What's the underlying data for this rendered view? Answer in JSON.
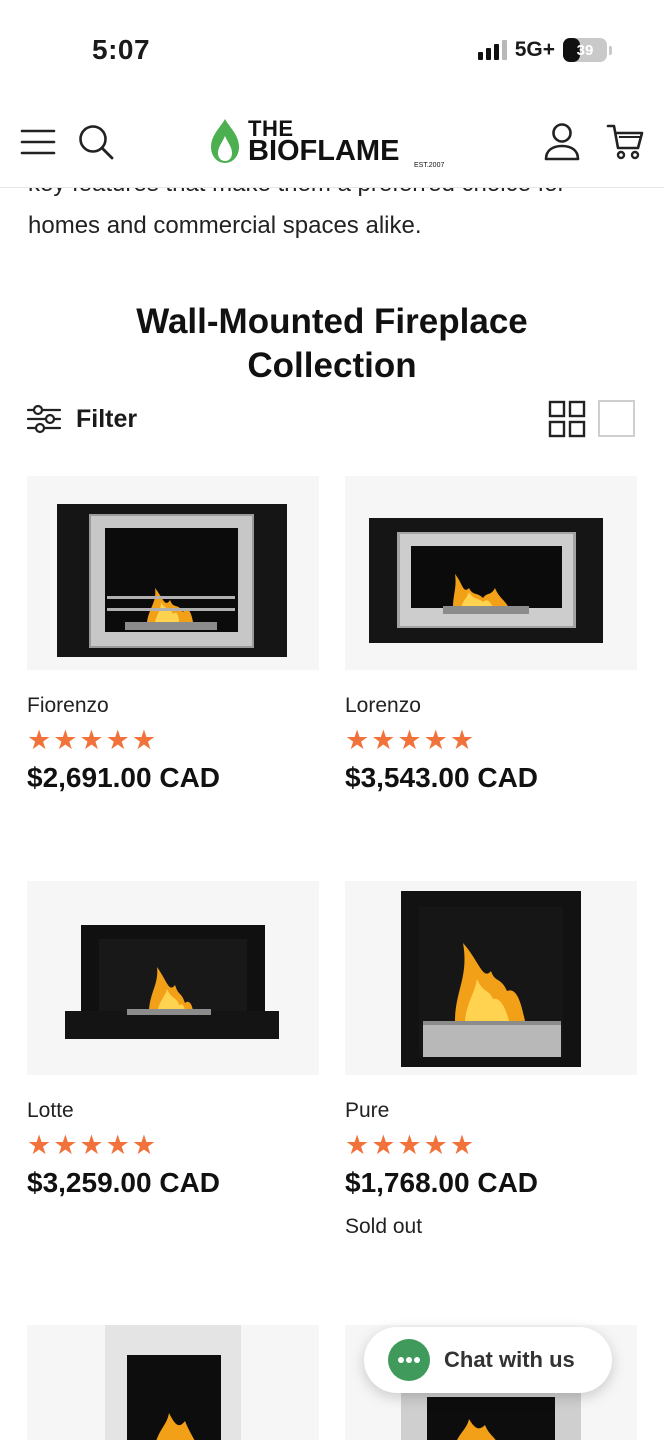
{
  "status_bar": {
    "time": "5:07",
    "network": "5G+",
    "battery": "39",
    "battery_level": 0.39
  },
  "header": {
    "logo_line1": "THE",
    "logo_line2": "BIOFLAME",
    "logo_est": "EST.2007",
    "brand_color": "#4caf50",
    "icons": [
      "menu-icon",
      "search-icon",
      "account-icon",
      "cart-icon"
    ]
  },
  "intro": {
    "partial_line": "key features that make them a preferred choice for",
    "last_line": "homes and commercial spaces alike."
  },
  "collection": {
    "title_line1": "Wall-Mounted Fireplace",
    "title_line2": "Collection",
    "filter_label": "Filter"
  },
  "products": [
    {
      "name": "Fiorenzo",
      "stars": "★★★★★",
      "rating": 5,
      "price": "$2,691.00 CAD"
    },
    {
      "name": "Lorenzo",
      "stars": "★★★★★",
      "rating": 5,
      "price": "$3,543.00 CAD"
    },
    {
      "name": "Lotte",
      "stars": "★★★★★",
      "rating": 5,
      "price": "$3,259.00 CAD"
    },
    {
      "name": "Pure",
      "stars": "★★★★★",
      "rating": 5,
      "price": "$1,768.00 CAD",
      "status": "Sold out"
    }
  ],
  "chat": {
    "label": "Chat with us",
    "color": "#3f9a5c"
  },
  "colors": {
    "star": "#f1733b",
    "text": "#111111"
  }
}
